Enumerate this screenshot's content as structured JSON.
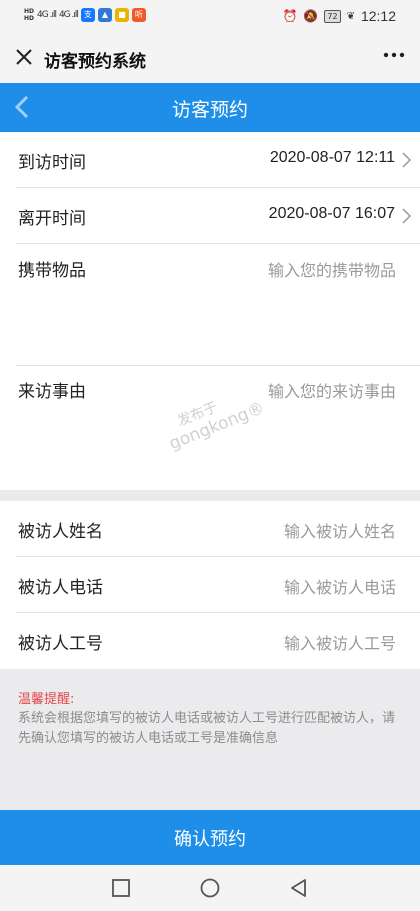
{
  "status_bar": {
    "time": "12:12",
    "battery": "72",
    "signal_1": "4G .ıll",
    "signal_2": "4G .ıll"
  },
  "titlebar": {
    "title": "访客预约系统",
    "close_icon": "close-icon",
    "more_icon": "more-icon"
  },
  "header": {
    "title": "访客预约",
    "back_icon": "back-chevron-icon",
    "color": "#1f8ee9"
  },
  "form": {
    "arrival": {
      "label": "到访时间",
      "value": "2020-08-07 12:11"
    },
    "departure": {
      "label": "离开时间",
      "value": "2020-08-07 16:07"
    },
    "items": {
      "label": "携带物品",
      "placeholder": "输入您的携带物品"
    },
    "reason": {
      "label": "来访事由",
      "placeholder": "输入您的来访事由"
    },
    "visitee_name": {
      "label": "被访人姓名",
      "placeholder": "输入被访人姓名"
    },
    "visitee_phone": {
      "label": "被访人电话",
      "placeholder": "输入被访人电话"
    },
    "visitee_id": {
      "label": "被访人工号",
      "placeholder": "输入被访人工号"
    }
  },
  "watermark": {
    "line1": "发布于",
    "line2": "gongkong®"
  },
  "reminder": {
    "title": "温馨提醒:",
    "text": "系统会根据您填写的被访人电话或被访人工号进行匹配被访人，请先确认您填写的被访人电话或工号是准确信息",
    "title_color": "#e5484d"
  },
  "confirm_button": {
    "label": "确认预约"
  },
  "nav": {
    "recents": "square-icon",
    "home": "circle-icon",
    "back": "triangle-back-icon"
  }
}
